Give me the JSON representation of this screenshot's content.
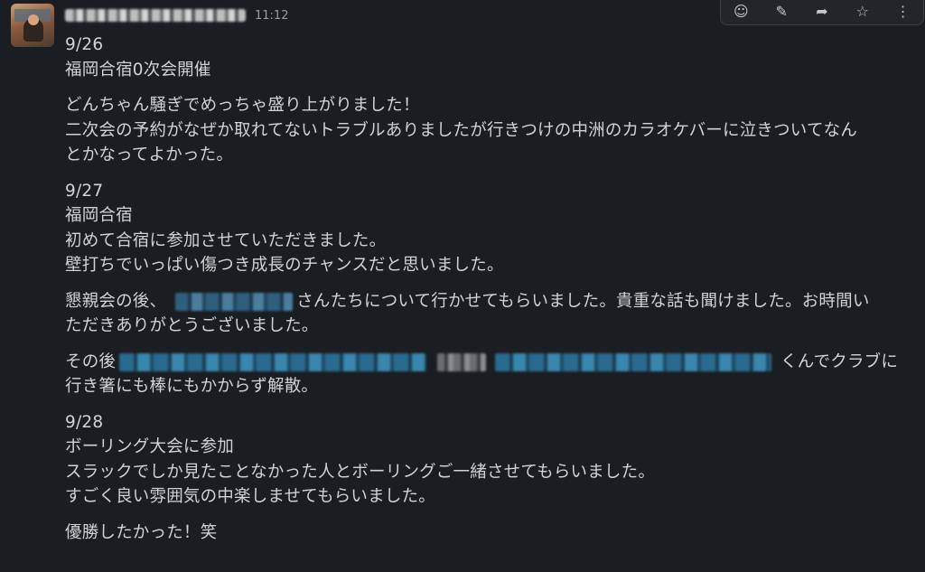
{
  "message": {
    "time": "11:12",
    "author_name": "",
    "lines": [
      "9/26",
      "福岡合宿0次会開催",
      "どんちゃん騒ぎでめっちゃ盛り上がりました！",
      "二次会の予約がなぜか取れてないトラブルありましたが行きつけの中洲のカラオケバーに泣きついてなん",
      "とかなってよかった。",
      "9/27",
      "福岡合宿",
      "初めて合宿に参加させていただきました。",
      "壁打ちでいっぱい傷つき成長のチャンスだと思いました。",
      "懇親会の後、",
      "さんたちについて行かせてもらいました。貴重な話も聞けました。お時間い",
      "ただきありがとうございました。",
      "その後",
      "くんでクラブに",
      "行き箸にも棒にもかからず解散。",
      "9/28",
      "ボーリング大会に参加",
      "スラックでしか見たことなかった人とボーリングご一緒させてもらいました。",
      "すごく良い雰囲気の中楽しませてもらいました。",
      "優勝したかった！笑"
    ]
  },
  "toolbar": {
    "icons": [
      "emoji-reaction-icon",
      "reply-thread-icon",
      "forward-icon",
      "bookmark-icon",
      "more-actions-icon"
    ]
  }
}
